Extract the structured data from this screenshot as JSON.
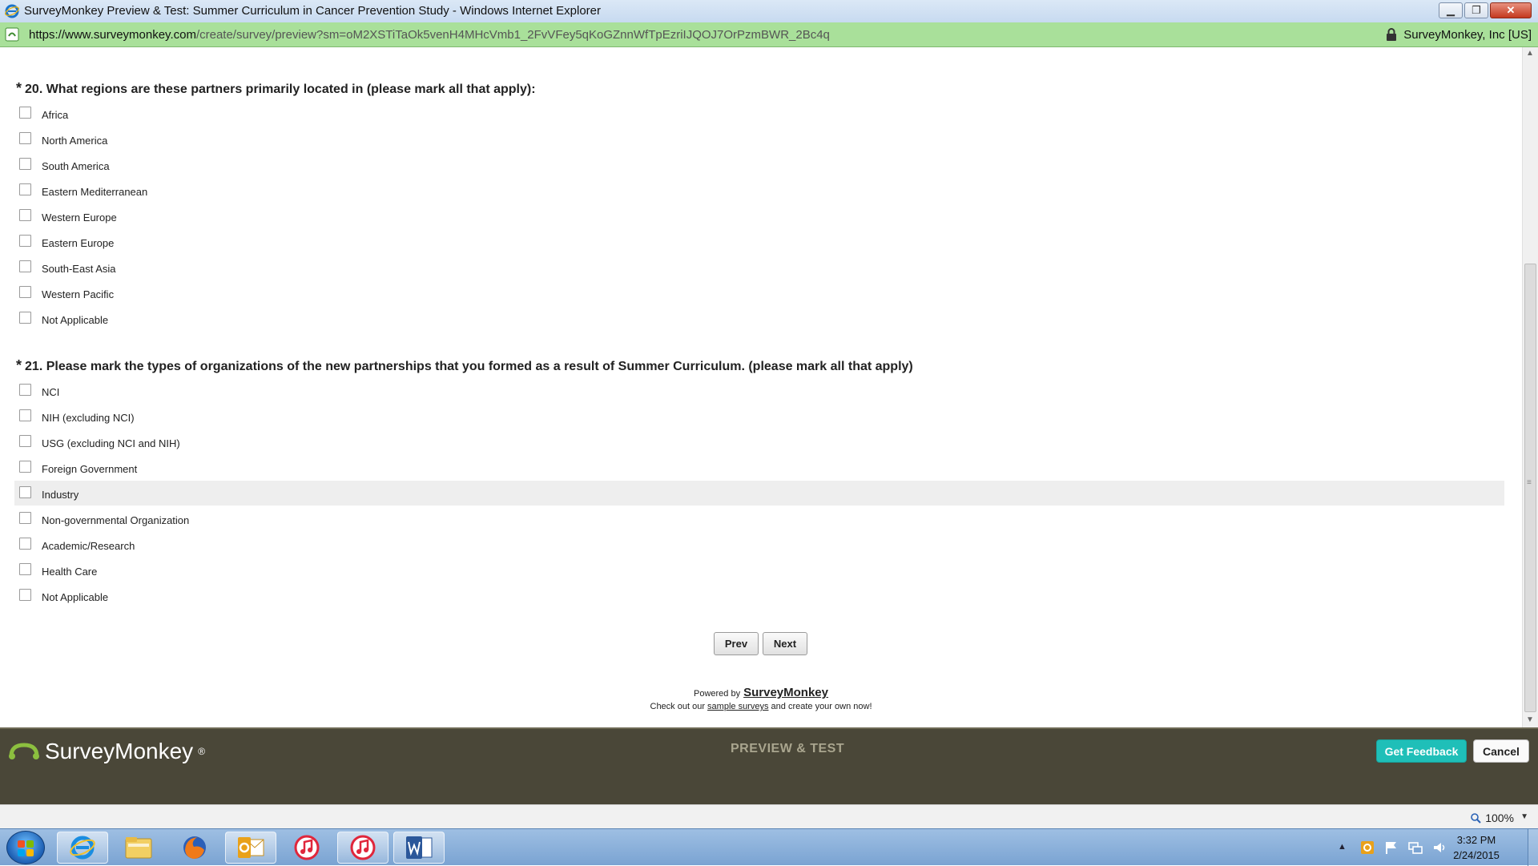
{
  "window": {
    "title": "SurveyMonkey Preview & Test: Summer Curriculum in Cancer Prevention Study - Windows Internet Explorer",
    "minimize_glyph": "▁",
    "restore_glyph": "❐",
    "close_glyph": "✕"
  },
  "address": {
    "url_host": "https://www.surveymonkey.com",
    "url_path": "/create/survey/preview?sm=oM2XSTiTaOk5venH4MHcVmb1_2FvVFey5qKoGZnnWfTpEzriIJQOJ7OrPzmBWR_2Bc4q",
    "identity": "SurveyMonkey, Inc [US]"
  },
  "questions": [
    {
      "required_mark": "*",
      "title": "20. What regions are these partners primarily located in (please mark all that apply):",
      "options": [
        "Africa",
        "North America",
        "South America",
        "Eastern Mediterranean",
        "Western Europe",
        "Eastern Europe",
        "South-East Asia",
        "Western Pacific",
        "Not Applicable"
      ]
    },
    {
      "required_mark": "*",
      "title": "21. Please mark the types of organizations of the new partnerships that you formed as a result of Summer Curriculum. (please mark all that apply)",
      "options": [
        "NCI",
        "NIH (excluding NCI)",
        "USG (excluding NCI and NIH)",
        "Foreign Government",
        "Industry",
        "Non-governmental Organization",
        "Academic/Research",
        "Health Care",
        "Not Applicable"
      ]
    }
  ],
  "nav": {
    "prev_label": "Prev",
    "next_label": "Next"
  },
  "footer": {
    "powered_by": "Powered by",
    "brand": "SurveyMonkey",
    "check_out": "Check out our",
    "sample_link": "sample surveys",
    "create_own": "and create your own now!"
  },
  "smbar": {
    "logo_text": "SurveyMonkey",
    "registered": "®",
    "preview_label": "PREVIEW & TEST",
    "get_feedback_label": "Get Feedback",
    "cancel_label": "Cancel"
  },
  "status": {
    "zoom": "100%"
  },
  "taskbar": {
    "time": "3:32 PM",
    "date": "2/24/2015",
    "items": [
      "internet-explorer-icon",
      "file-explorer-icon",
      "firefox-icon",
      "outlook-icon",
      "itunes-icon",
      "itunes-icon",
      "word-icon"
    ]
  },
  "colors": {
    "address_bar": "#a9e09a",
    "sm_bar": "#4a4738",
    "get_feedback": "#1fbfb8",
    "hover_row": "#eeeeee"
  }
}
